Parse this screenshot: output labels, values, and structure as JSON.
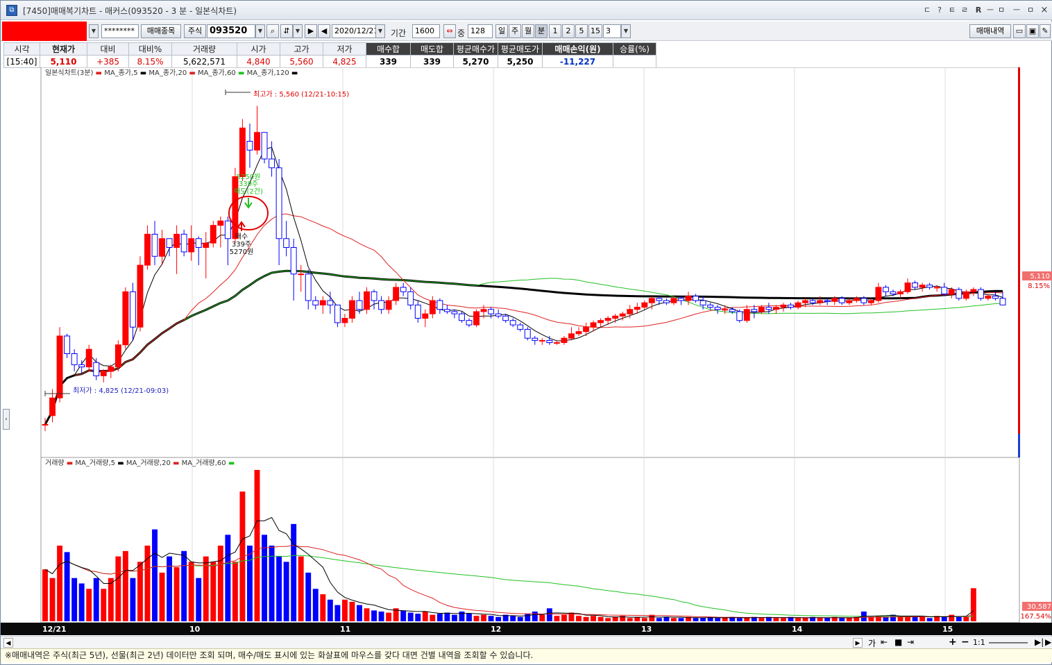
{
  "title": "[7450]매매복기차트 - 매커스(093520 - 3 분 - 일본식차트)",
  "title_buttons": [
    "ㄷ",
    "?",
    "ㅌ",
    "ㄹ",
    "R",
    "ㅡ",
    "ㅁ",
    "ㅡ",
    "ㅁ",
    "×"
  ],
  "toolbar": {
    "password": "********",
    "trade_stock_btn": "매매종목",
    "market_type": "주식",
    "code": "093520",
    "date": "2020/12/21",
    "period_label": "기간",
    "period_value": "1600",
    "count_label": "중",
    "count_value": "128",
    "tf_buttons": [
      "일",
      "주",
      "월",
      "분",
      "1",
      "2",
      "5",
      "15"
    ],
    "tf_selected": "분",
    "minute_value": "3",
    "trade_history_btn": "매매내역"
  },
  "quote": {
    "headers": [
      "시각",
      "현재가",
      "대비",
      "대비%",
      "거래량",
      "시가",
      "고가",
      "저가",
      "매수합",
      "매도합",
      "평균매수가",
      "평균매도가",
      "매매손익(원)",
      "승률(%)"
    ],
    "values": [
      "[15:40]",
      "5,110",
      "+385",
      "8.15%",
      "5,622,571",
      "4,840",
      "5,560",
      "4,825",
      "339",
      "339",
      "5,270",
      "5,250",
      "-11,227",
      ""
    ]
  },
  "price_legend": [
    "일본식차트(3분)",
    "MA_종가,5",
    "MA_종가,20",
    "MA_종가,60",
    "MA_종가,120"
  ],
  "volume_legend": [
    "거래량",
    "MA_거래량,5",
    "MA_거래량,20",
    "MA_거래량,60"
  ],
  "annotations": {
    "high": "최고가 : 5,560 (12/21-10:15)",
    "low": "최저가 : 4,825 (12/21-09:03)",
    "sell_line1": "5250원",
    "sell_line2": "339주",
    "sell_line3": "매도(2건)",
    "buy_line1": "매수",
    "buy_line2": "339주",
    "buy_line3": "5270원"
  },
  "price_axis": {
    "current": "5,110",
    "change": "8.15%"
  },
  "volume_axis": {
    "current": "30,587",
    "change": "167.54%"
  },
  "x_axis_labels": [
    "12/21",
    "10",
    "11",
    "12",
    "13",
    "14",
    "15"
  ],
  "status_text": "※매매내역은 주식(최근 5년), 선물(최근 2년) 데이터만 조회 되며, 매수/매도 표시에 있는 화살표에 마우스를 갖다 대면 건별 내역을 조회할 수 있습니다.",
  "scroll_controls": [
    "가",
    "⇤",
    "■",
    "⇥",
    "+",
    "−",
    "1:1"
  ],
  "colors": {
    "up": "#ff0000",
    "down": "#0000ff",
    "ma5": "#000000",
    "ma20": "#e02020",
    "ma60": "#22c022",
    "ma120": "#000000"
  },
  "chart_data": {
    "type": "candlestick",
    "price_range": [
      4800,
      5600
    ],
    "candles": [
      [
        4840,
        4855,
        4825,
        4840
      ],
      [
        4860,
        4920,
        4845,
        4900
      ],
      [
        4900,
        5060,
        4890,
        5040
      ],
      [
        5040,
        5045,
        4990,
        5000
      ],
      [
        5000,
        5010,
        4960,
        4975
      ],
      [
        4975,
        4985,
        4955,
        4970
      ],
      [
        4970,
        5020,
        4960,
        5010
      ],
      [
        4980,
        4990,
        4940,
        4950
      ],
      [
        4950,
        4965,
        4935,
        4960
      ],
      [
        4960,
        4975,
        4945,
        4970
      ],
      [
        4970,
        5030,
        4960,
        5020
      ],
      [
        5020,
        5150,
        5010,
        5140
      ],
      [
        5140,
        5160,
        5030,
        5060
      ],
      [
        5060,
        5220,
        5050,
        5200
      ],
      [
        5200,
        5290,
        5190,
        5270
      ],
      [
        5270,
        5300,
        5200,
        5220
      ],
      [
        5220,
        5280,
        5200,
        5260
      ],
      [
        5260,
        5250,
        5220,
        5240
      ],
      [
        5240,
        5290,
        5180,
        5270
      ],
      [
        5270,
        5280,
        5220,
        5230
      ],
      [
        5230,
        5290,
        5210,
        5260
      ],
      [
        5260,
        5265,
        5200,
        5240
      ],
      [
        5240,
        5275,
        5170,
        5250
      ],
      [
        5250,
        5300,
        5240,
        5290
      ],
      [
        5290,
        5310,
        5240,
        5300
      ],
      [
        5300,
        5310,
        5200,
        5260
      ],
      [
        5260,
        5420,
        5250,
        5400
      ],
      [
        5400,
        5530,
        5390,
        5510
      ],
      [
        5480,
        5520,
        5420,
        5460
      ],
      [
        5460,
        5560,
        5450,
        5500
      ],
      [
        5500,
        5500,
        5430,
        5440
      ],
      [
        5440,
        5480,
        5400,
        5420
      ],
      [
        5420,
        5440,
        5200,
        5260
      ],
      [
        5260,
        5300,
        5220,
        5240
      ],
      [
        5240,
        5260,
        5120,
        5180
      ],
      [
        5180,
        5200,
        5140,
        5180
      ],
      [
        5180,
        5190,
        5100,
        5120
      ],
      [
        5120,
        5130,
        5100,
        5110
      ],
      [
        5110,
        5130,
        5090,
        5120
      ],
      [
        5120,
        5140,
        5090,
        5110
      ],
      [
        5110,
        5110,
        5060,
        5070
      ],
      [
        5070,
        5090,
        5060,
        5080
      ],
      [
        5080,
        5130,
        5070,
        5120
      ],
      [
        5120,
        5140,
        5090,
        5100
      ],
      [
        5100,
        5150,
        5090,
        5140
      ],
      [
        5140,
        5145,
        5100,
        5120
      ],
      [
        5120,
        5130,
        5090,
        5100
      ],
      [
        5100,
        5130,
        5090,
        5120
      ],
      [
        5120,
        5160,
        5110,
        5150
      ],
      [
        5150,
        5160,
        5130,
        5140
      ],
      [
        5140,
        5150,
        5100,
        5110
      ],
      [
        5110,
        5120,
        5070,
        5080
      ],
      [
        5080,
        5100,
        5060,
        5090
      ],
      [
        5090,
        5130,
        5080,
        5120
      ],
      [
        5120,
        5125,
        5090,
        5100
      ],
      [
        5100,
        5110,
        5090,
        5095
      ],
      [
        5095,
        5100,
        5080,
        5090
      ],
      [
        5090,
        5095,
        5070,
        5075
      ],
      [
        5075,
        5080,
        5060,
        5065
      ],
      [
        5065,
        5100,
        5060,
        5095
      ],
      [
        5095,
        5110,
        5080,
        5100
      ],
      [
        5100,
        5105,
        5080,
        5090
      ],
      [
        5090,
        5100,
        5080,
        5085
      ],
      [
        5085,
        5090,
        5070,
        5075
      ],
      [
        5075,
        5080,
        5060,
        5065
      ],
      [
        5065,
        5070,
        5050,
        5055
      ],
      [
        5055,
        5060,
        5030,
        5035
      ],
      [
        5035,
        5040,
        5020,
        5030
      ],
      [
        5030,
        5035,
        5020,
        5030
      ],
      [
        5030,
        5040,
        5020,
        5025
      ],
      [
        5025,
        5030,
        5020,
        5025
      ],
      [
        5025,
        5040,
        5020,
        5035
      ],
      [
        5035,
        5060,
        5030,
        5045
      ],
      [
        5045,
        5060,
        5040,
        5050
      ],
      [
        5050,
        5070,
        5040,
        5060
      ],
      [
        5060,
        5075,
        5050,
        5070
      ],
      [
        5070,
        5080,
        5060,
        5075
      ],
      [
        5075,
        5085,
        5065,
        5080
      ],
      [
        5080,
        5090,
        5070,
        5085
      ],
      [
        5085,
        5095,
        5075,
        5090
      ],
      [
        5090,
        5110,
        5080,
        5100
      ],
      [
        5100,
        5115,
        5090,
        5105
      ],
      [
        5105,
        5120,
        5100,
        5115
      ],
      [
        5115,
        5130,
        5100,
        5125
      ],
      [
        5125,
        5130,
        5110,
        5120
      ],
      [
        5120,
        5125,
        5110,
        5115
      ],
      [
        5115,
        5130,
        5110,
        5125
      ],
      [
        5125,
        5130,
        5110,
        5120
      ],
      [
        5120,
        5140,
        5110,
        5130
      ],
      [
        5130,
        5135,
        5115,
        5120
      ],
      [
        5120,
        5130,
        5100,
        5110
      ],
      [
        5110,
        5115,
        5100,
        5105
      ],
      [
        5105,
        5110,
        5090,
        5100
      ],
      [
        5100,
        5110,
        5090,
        5100
      ],
      [
        5100,
        5105,
        5090,
        5095
      ],
      [
        5095,
        5100,
        5070,
        5075
      ],
      [
        5075,
        5110,
        5070,
        5100
      ],
      [
        5100,
        5110,
        5080,
        5095
      ],
      [
        5095,
        5110,
        5090,
        5105
      ],
      [
        5105,
        5115,
        5090,
        5100
      ],
      [
        5100,
        5110,
        5090,
        5105
      ],
      [
        5105,
        5115,
        5095,
        5110
      ],
      [
        5110,
        5115,
        5100,
        5105
      ],
      [
        5105,
        5120,
        5100,
        5115
      ],
      [
        5115,
        5125,
        5105,
        5120
      ],
      [
        5120,
        5125,
        5110,
        5115
      ],
      [
        5115,
        5130,
        5110,
        5120
      ],
      [
        5120,
        5125,
        5110,
        5118
      ],
      [
        5118,
        5130,
        5110,
        5125
      ],
      [
        5125,
        5130,
        5110,
        5115
      ],
      [
        5115,
        5125,
        5110,
        5120
      ],
      [
        5120,
        5130,
        5115,
        5125
      ],
      [
        5125,
        5130,
        5110,
        5115
      ],
      [
        5115,
        5125,
        5110,
        5120
      ],
      [
        5120,
        5160,
        5115,
        5150
      ],
      [
        5150,
        5155,
        5130,
        5140
      ],
      [
        5140,
        5145,
        5130,
        5135
      ],
      [
        5135,
        5145,
        5125,
        5140
      ],
      [
        5140,
        5170,
        5135,
        5160
      ],
      [
        5160,
        5165,
        5145,
        5150
      ],
      [
        5150,
        5160,
        5140,
        5155
      ],
      [
        5155,
        5160,
        5145,
        5150
      ],
      [
        5150,
        5155,
        5140,
        5150
      ],
      [
        5150,
        5160,
        5130,
        5135
      ],
      [
        5135,
        5150,
        5125,
        5145
      ],
      [
        5145,
        5150,
        5120,
        5125
      ],
      [
        5125,
        5145,
        5120,
        5140
      ],
      [
        5140,
        5150,
        5130,
        5145
      ],
      [
        5145,
        5150,
        5120,
        5125
      ],
      [
        5125,
        5135,
        5120,
        5130
      ],
      [
        5130,
        5140,
        5120,
        5125
      ],
      [
        5125,
        5140,
        5110,
        5110
      ]
    ],
    "volumes": [
      48000,
      40000,
      70000,
      64000,
      40000,
      35000,
      30000,
      40000,
      30000,
      40000,
      60000,
      65000,
      40000,
      55000,
      70000,
      85000,
      45000,
      60000,
      50000,
      65000,
      55000,
      40000,
      60000,
      55000,
      70000,
      80000,
      55000,
      120000,
      70000,
      140000,
      80000,
      70000,
      60000,
      55000,
      90000,
      60000,
      45000,
      30000,
      25000,
      20000,
      15000,
      20000,
      18000,
      15000,
      12000,
      10000,
      9000,
      8000,
      12000,
      10000,
      8000,
      7000,
      9000,
      6000,
      7000,
      8000,
      6000,
      9000,
      7000,
      5000,
      6000,
      5000,
      4000,
      6000,
      5000,
      4000,
      7000,
      9000,
      6000,
      12000,
      5000,
      6000,
      8000,
      5000,
      4000,
      5000,
      4000,
      3000,
      4000,
      5000,
      3000,
      4000,
      3000,
      6000,
      3000,
      4000,
      3000,
      3000,
      4000,
      3000,
      3000,
      4000,
      3000,
      3000,
      4000,
      3000,
      3000,
      4000,
      3000,
      4000,
      3000,
      3000,
      4000,
      3000,
      3000,
      4000,
      3000,
      3000,
      4000,
      3000,
      3000,
      4000,
      9000,
      4000,
      5000,
      4000,
      6000,
      5000,
      4000,
      5000,
      4000,
      3000,
      5000,
      4000,
      6000,
      4000,
      4000,
      30587
    ],
    "trades": [
      {
        "side": "sell",
        "price": 5250,
        "qty": 339
      },
      {
        "side": "buy",
        "price": 5270,
        "qty": 339
      }
    ]
  }
}
